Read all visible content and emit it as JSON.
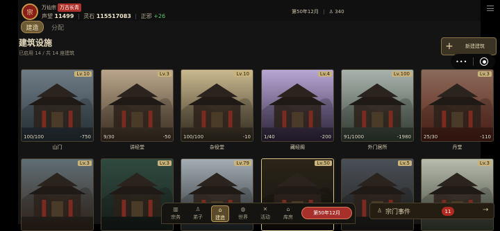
{
  "header": {
    "avatar_glyph": "宗",
    "sect_name": "万仙宗",
    "sect_badge": "万古长青",
    "prestige_label": "声望",
    "prestige_value": "11499",
    "spirit_label": "灵石",
    "spirit_value": "115517083",
    "righteous_label": "正邪",
    "righteous_delta": "+26",
    "month_label": "第50年12月",
    "population_icon": "person-icon",
    "population": "340"
  },
  "tabs": [
    {
      "label": "建造",
      "active": true
    },
    {
      "label": "分配",
      "active": false
    }
  ],
  "section": {
    "title": "建筑设施",
    "subtitle": "已启用 14 / 共 14 座建筑",
    "new_button": "新建建筑"
  },
  "capsule": {
    "more": "•••",
    "record_icon": "record-icon"
  },
  "buildings": [
    {
      "name": "山门",
      "level": "Lv.10",
      "capacity": "100/100",
      "upkeep": "-750",
      "tone": [
        "#6f7c86",
        "#2e3a42"
      ]
    },
    {
      "name": "讲经堂",
      "level": "Lv.3",
      "capacity": "9/30",
      "upkeep": "-50",
      "tone": [
        "#b8a58a",
        "#4a3b2c"
      ]
    },
    {
      "name": "杂役堂",
      "level": "Lv.10",
      "capacity": "100/100",
      "upkeep": "-10",
      "tone": [
        "#c9b98f",
        "#3e3526"
      ]
    },
    {
      "name": "藏经阁",
      "level": "Lv.4",
      "capacity": "1/40",
      "upkeep": "-200",
      "tone": [
        "#b7a7d4",
        "#3a2d4a"
      ]
    },
    {
      "name": "外门居所",
      "level": "Lv.100",
      "capacity": "91/1000",
      "upkeep": "-1980",
      "tone": [
        "#a9b3ae",
        "#3d4a3e"
      ]
    },
    {
      "name": "丹堂",
      "level": "Lv.3",
      "capacity": "25/30",
      "upkeep": "-110",
      "tone": [
        "#8b6a5a",
        "#5a2418"
      ]
    },
    {
      "name": "",
      "level": "Lv.3",
      "capacity": "",
      "upkeep": "",
      "tone": [
        "#5f6e75",
        "#3a2a20"
      ]
    },
    {
      "name": "",
      "level": "Lv.3",
      "capacity": "",
      "upkeep": "",
      "tone": [
        "#2f4a3e",
        "#1c2420"
      ]
    },
    {
      "name": "",
      "level": "Lv.79",
      "capacity": "",
      "upkeep": "",
      "tone": [
        "#a3adb3",
        "#2a2f33"
      ]
    },
    {
      "name": "",
      "level": "Lv.50",
      "capacity": "",
      "upkeep": "",
      "tone": [
        "#2a2418",
        "#171410"
      ]
    },
    {
      "name": "",
      "level": "Lv.5",
      "capacity": "",
      "upkeep": "",
      "tone": [
        "#4a5057",
        "#22201e"
      ]
    },
    {
      "name": "",
      "level": "Lv.3",
      "capacity": "",
      "upkeep": "",
      "tone": [
        "#b8bcae",
        "#3c4436"
      ]
    }
  ],
  "nav": [
    {
      "label": "宗务",
      "icon": "chart-icon",
      "glyph": "▥"
    },
    {
      "label": "弟子",
      "icon": "person-icon",
      "glyph": "♙"
    },
    {
      "label": "建造",
      "icon": "building-icon",
      "glyph": "⌂"
    },
    {
      "label": "世界",
      "icon": "globe-icon",
      "glyph": "◍"
    },
    {
      "label": "活动",
      "icon": "swords-icon",
      "glyph": "✕"
    },
    {
      "label": "库房",
      "icon": "storehouse-icon",
      "glyph": "⌂"
    }
  ],
  "turn_button": "第50年12月",
  "events": {
    "label": "宗门事件",
    "count": "11",
    "icon": "person-icon"
  }
}
